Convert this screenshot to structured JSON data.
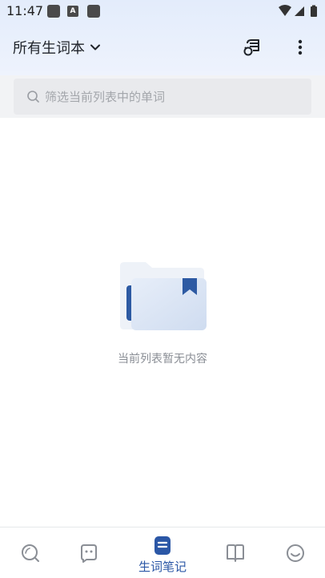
{
  "status_bar": {
    "time": "11:47",
    "notif_badge": "A"
  },
  "app_bar": {
    "title": "所有生词本",
    "title_icon": "chevron-down-icon",
    "actions": [
      "sync-icon",
      "more-vert-icon"
    ]
  },
  "search": {
    "placeholder": "筛选当前列表中的单词",
    "value": ""
  },
  "empty_state": {
    "message": "当前列表暂无内容"
  },
  "bottom_nav": {
    "items": [
      {
        "icon": "search-icon",
        "active": false
      },
      {
        "icon": "chat-icon",
        "active": false
      },
      {
        "icon": "vocab-note-icon",
        "label": "生词笔记",
        "active": true
      },
      {
        "icon": "book-icon",
        "active": false
      },
      {
        "icon": "smile-icon",
        "active": false
      }
    ]
  },
  "colors": {
    "accent": "#2b57a6",
    "header_bg": "#e3ecfb",
    "search_bg": "#e9eaed"
  }
}
